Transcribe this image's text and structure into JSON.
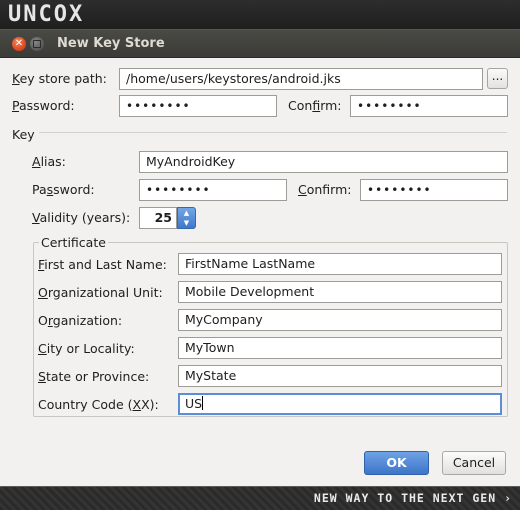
{
  "brand": {
    "logo_text": "UNCOX",
    "tagline": "NEW WAY TO THE NEXT GEN ›"
  },
  "window": {
    "title": "New Key Store",
    "close_icon": "✕"
  },
  "keystore": {
    "path_label_pre": "",
    "path_label_mnemonic": "K",
    "path_label_post": "ey store path:",
    "path_value": "/home/users/keystores/android.jks",
    "browse_label": "...",
    "password_label_mnemonic": "P",
    "password_label_post": "assword:",
    "password_value": "••••••••",
    "confirm_label_pre": "Con",
    "confirm_label_mnemonic": "f",
    "confirm_label_post": "irm:",
    "confirm_value": "••••••••"
  },
  "key": {
    "section_label": "Key",
    "alias_label_mnemonic": "A",
    "alias_label_post": "lias:",
    "alias_value": "MyAndroidKey",
    "password_label_pre": "Pa",
    "password_label_mnemonic": "s",
    "password_label_post": "sword:",
    "password_value": "••••••••",
    "confirm_label_mnemonic": "C",
    "confirm_label_post": "onfirm:",
    "confirm_value": "••••••••",
    "validity_label_mnemonic": "V",
    "validity_label_post": "alidity (years):",
    "validity_value": "25"
  },
  "certificate": {
    "group_label": "Certificate",
    "fields": [
      {
        "label_mnemonic": "F",
        "label_post": "irst and Last Name:",
        "value": "FirstName LastName"
      },
      {
        "label_mnemonic": "O",
        "label_post": "rganizational Unit:",
        "value": "Mobile Development"
      },
      {
        "label_pre": "O",
        "label_mnemonic": "r",
        "label_post": "ganization:",
        "value": "MyCompany"
      },
      {
        "label_mnemonic": "C",
        "label_post": "ity or Locality:",
        "value": "MyTown"
      },
      {
        "label_mnemonic": "S",
        "label_post": "tate or Province:",
        "value": "MyState"
      },
      {
        "label_pre": "Country Code (",
        "label_mnemonic": "X",
        "label_post": "X):",
        "value": "US"
      }
    ]
  },
  "buttons": {
    "ok": "OK",
    "cancel": "Cancel"
  }
}
